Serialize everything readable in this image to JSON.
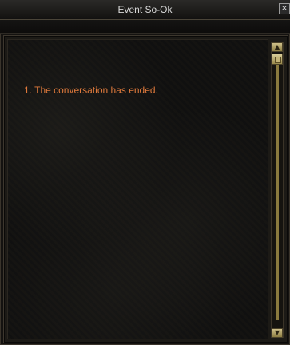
{
  "window": {
    "title": "Event So-Ok",
    "close_glyph": "×"
  },
  "messages": [
    "1. The conversation has ended."
  ],
  "icons": {
    "close": "close-icon",
    "scroll_up": "scroll-up-arrow-icon",
    "scroll_down": "scroll-down-arrow-icon"
  },
  "colors": {
    "message_text": "#e07a3c",
    "title_text": "#d8d8d8",
    "scrollbar_accent": "#bfae6c"
  },
  "scroll": {
    "up_glyph": "▲",
    "down_glyph": "▼"
  }
}
